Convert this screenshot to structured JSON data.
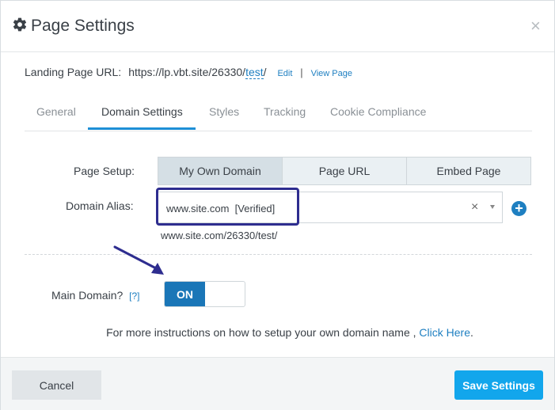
{
  "header": {
    "title": "Page Settings",
    "icon": "gear-icon",
    "close": "×"
  },
  "landing_url": {
    "label": "Landing Page URL:",
    "base": "https://lp.vbt.site/26330/",
    "slug": "test",
    "trail": "/",
    "edit": "Edit",
    "separator": "|",
    "view": "View Page"
  },
  "tabs": [
    {
      "label": "General",
      "active": false
    },
    {
      "label": "Domain Settings",
      "active": true
    },
    {
      "label": "Styles",
      "active": false
    },
    {
      "label": "Tracking",
      "active": false
    },
    {
      "label": "Cookie Compliance",
      "active": false
    }
  ],
  "page_setup": {
    "label": "Page Setup:",
    "options": [
      "My Own Domain",
      "Page URL",
      "Embed Page"
    ],
    "selected": "My Own Domain"
  },
  "domain_alias": {
    "label": "Domain Alias:",
    "value": "www.site.com  [Verified]",
    "clear": "×",
    "preview": "www.site.com/26330/test/"
  },
  "main_domain": {
    "label": "Main Domain?",
    "help": "[?]",
    "toggle": "ON"
  },
  "instructions": {
    "text": "For more instructions on how to setup your own domain name , ",
    "link": "Click Here",
    "end": "."
  },
  "footer": {
    "cancel": "Cancel",
    "save": "Save Settings"
  },
  "colors": {
    "accent": "#1e7fc1",
    "save_button": "#12a6ec",
    "toggle_on": "#1a76b7",
    "highlight": "#2e2d8f"
  }
}
